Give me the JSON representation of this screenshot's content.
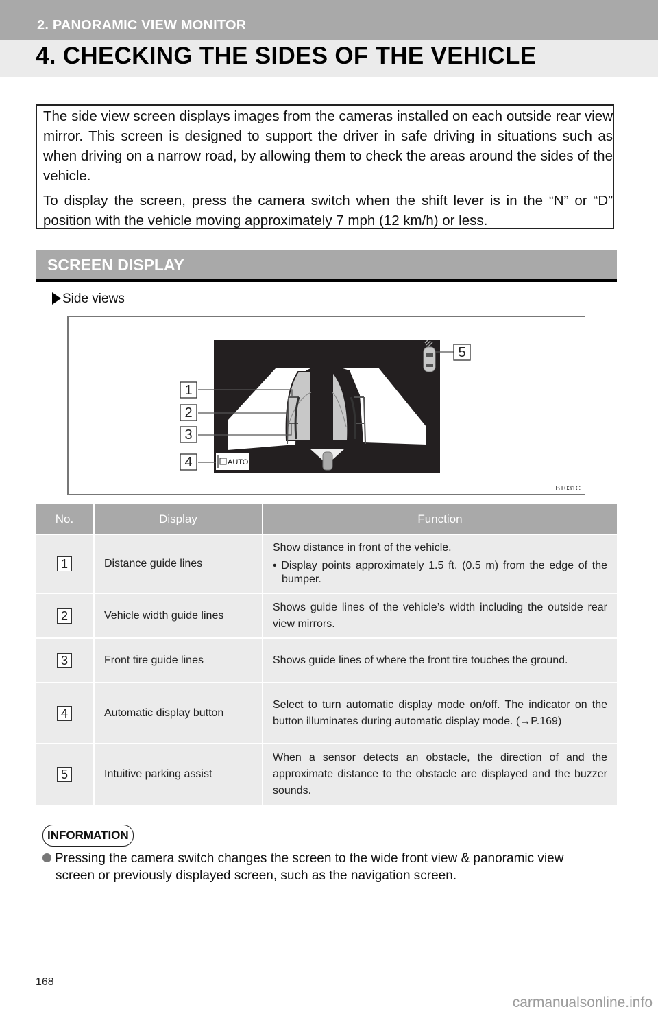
{
  "header": {
    "breadcrumb": "2. PANORAMIC VIEW MONITOR",
    "title": "4. CHECKING THE SIDES OF THE VEHICLE"
  },
  "intro": {
    "paragraph1": "The side view screen displays images from the cameras installed on each outside rear view mirror. This screen is designed to support the driver in safe driving in situations such as when driving on a narrow road, by allowing them to check the areas around the sides of the vehicle.",
    "paragraph2": "To display the screen, press the camera switch when the shift lever is in the “N” or “D” position with the vehicle moving approximately 7 mph (12 km/h) or less."
  },
  "section": {
    "title": "SCREEN DISPLAY",
    "subheading": "Side views"
  },
  "figure": {
    "callouts": [
      "1",
      "2",
      "3",
      "4",
      "5"
    ],
    "auto_button_label": "AUTO",
    "code": "BT031C",
    "colors": {
      "screen_bg": "#231f20",
      "ground": "#ffffff",
      "shaded": "#c8c8c8"
    }
  },
  "table": {
    "headers": {
      "no": "No.",
      "display": "Display",
      "function": "Function"
    },
    "rows": [
      {
        "no": "1",
        "display": "Distance guide lines",
        "function_lead": "Show distance in front of the vehicle.",
        "function_bullet": "• Display points approximately 1.5 ft. (0.5 m) from the edge of the bumper."
      },
      {
        "no": "2",
        "display": "Vehicle width guide lines",
        "function": "Shows guide lines of the vehicle’s width including the outside rear view mirrors."
      },
      {
        "no": "3",
        "display": "Front tire guide lines",
        "function": "Shows guide lines of where the front tire touches the ground."
      },
      {
        "no": "4",
        "display": "Automatic display button",
        "function": "Select to turn automatic display mode on/off. The indicator on the button illuminates during automatic display mode. (→P.169)"
      },
      {
        "no": "5",
        "display": "Intuitive parking assist",
        "function": "When a sensor detects an obstacle, the direction of and the approximate distance to the obstacle are displayed and the buzzer sounds."
      }
    ]
  },
  "information": {
    "badge": "INFORMATION",
    "text_line1": "Pressing the camera switch changes the screen to the wide front view & panoramic view",
    "text_line2": "screen or previously displayed screen, such as the navigation screen."
  },
  "footer": {
    "page_number": "168",
    "watermark": "carmanualsonline.info"
  }
}
